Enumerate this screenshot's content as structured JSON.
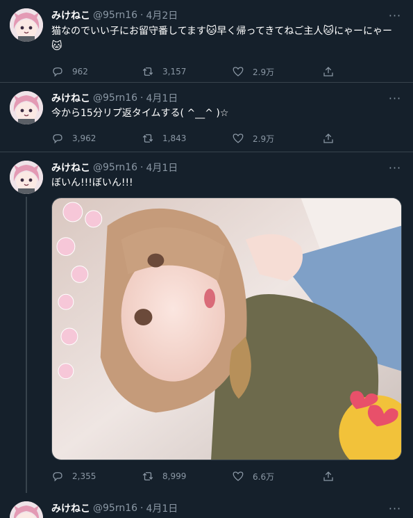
{
  "tweets": [
    {
      "name": "みけねこ",
      "handle": "@95rn16",
      "date": "4月2日",
      "text_parts": [
        "猫なのでいい子にお留守番してます",
        "早く帰ってきてねご主人",
        "にゃーにゃー",
        ""
      ],
      "cat_emoji": "🐱",
      "replies": "962",
      "retweets": "3,157",
      "likes": "2.9万"
    },
    {
      "name": "みけねこ",
      "handle": "@95rn16",
      "date": "4月1日",
      "text": "今から15分リプ返タイムする( ^__^ )☆",
      "replies": "3,962",
      "retweets": "1,843",
      "likes": "2.9万"
    },
    {
      "name": "みけねこ",
      "handle": "@95rn16",
      "date": "4月1日",
      "text": "ぼいん!!!ぼいん!!!",
      "replies": "2,355",
      "retweets": "8,999",
      "likes": "6.6万"
    },
    {
      "name": "みけねこ",
      "handle": "@95rn16",
      "date": "4月1日"
    }
  ],
  "separator_dot": "·",
  "more_glyph": "···",
  "icons": [
    "reply-icon",
    "retweet-icon",
    "like-icon",
    "share-icon",
    "more-icon"
  ],
  "colors": {
    "background": "#15202b",
    "border": "#38444d",
    "secondary_text": "#8b98a5",
    "primary_text": "#ffffff"
  }
}
